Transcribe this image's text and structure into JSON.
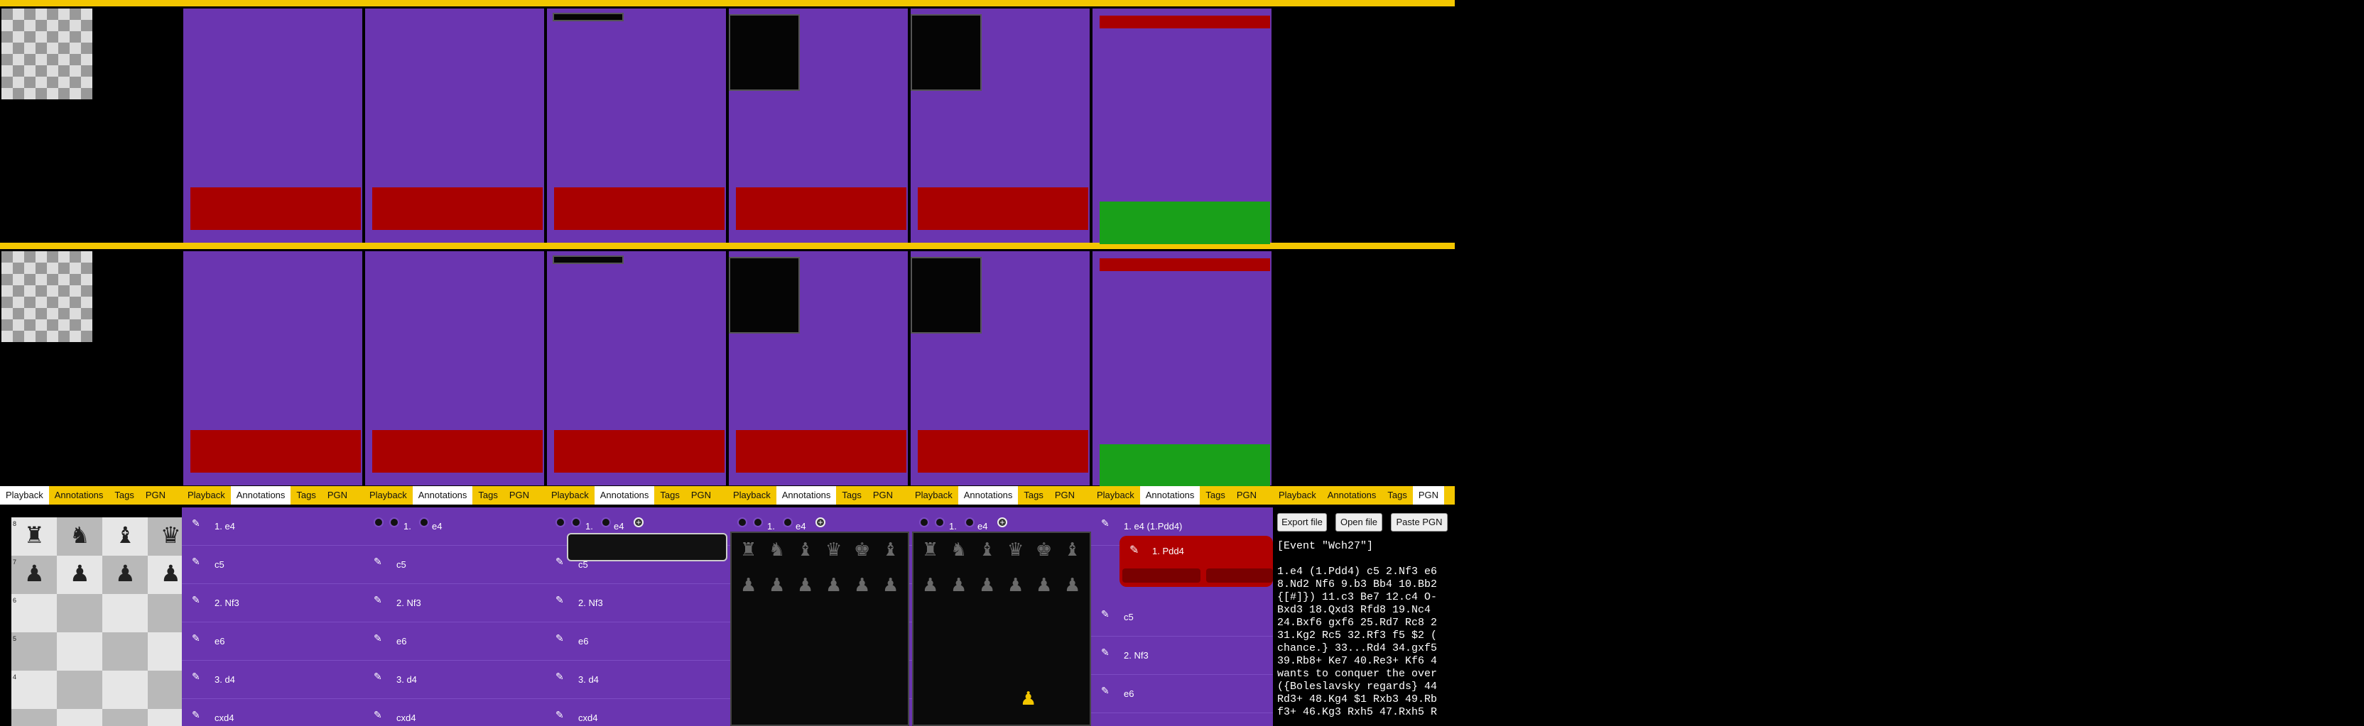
{
  "tabs": [
    "Playback",
    "Annotations",
    "Tags",
    "PGN"
  ],
  "moves": [
    {
      "n": "1.",
      "san": "e4"
    },
    {
      "n": "",
      "san": "c5"
    },
    {
      "n": "2.",
      "san": "Nf3"
    },
    {
      "n": "",
      "san": "e6"
    },
    {
      "n": "3.",
      "san": "d4"
    },
    {
      "n": "",
      "san": "cxd4"
    }
  ],
  "annotated_move": "1. e4 (1.Pdd4)",
  "variation_move": "1. Pdd4",
  "pgn_buttons": {
    "export": "Export file",
    "open": "Open file",
    "paste": "Paste PGN"
  },
  "pgn_text": [
    "[Event \"Wch27\"]",
    "",
    "1.e4 (1.Pdd4) c5 2.Nf3 e6",
    "8.Nd2 Nf6 9.b3 Bb4 10.Bb2",
    "{[#]}) 11.c3 Be7 12.c4 O-",
    "Bxd3 18.Qxd3 Rfd8 19.Nc4",
    "24.Bxf6 gxf6 25.Rd7 Rc8 2",
    "31.Kg2 Rc5 32.Rf3 f5 $2 (",
    "chance.} 33...Rd4 34.gxf5",
    "39.Rb8+ Ke7 40.Re3+ Kf6 4",
    "wants to conquer the over",
    "({Boleslavsky regards} 44",
    "Rd3+ 48.Kg4 $1 Rxb3 49.Rb",
    "f3+ 46.Kg3 Rxh5 47.Rxh5 R"
  ],
  "board_ranks": [
    "8",
    "7",
    "6",
    "5",
    "4"
  ],
  "icons": {
    "edit": "edit-icon",
    "nav": "nav-dot-icon",
    "add": "plus-icon"
  }
}
